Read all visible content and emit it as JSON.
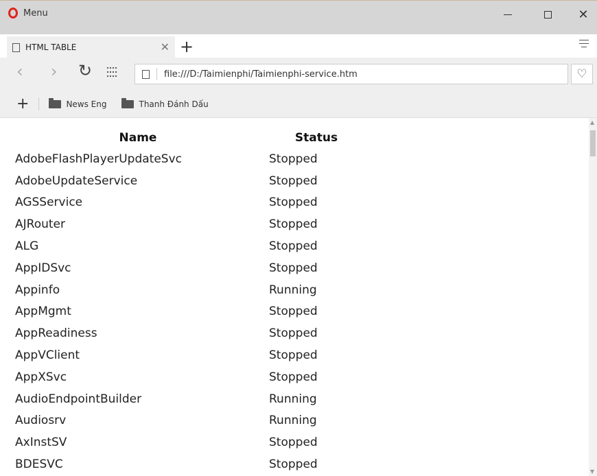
{
  "window": {
    "menu_label": "Menu",
    "minimize_glyph": "−",
    "maximize_glyph": "□",
    "close_glyph": "✕"
  },
  "tab": {
    "title": "HTML TABLE",
    "close_glyph": "✕",
    "new_glyph": "+"
  },
  "toolbar": {
    "back_glyph": "‹",
    "forward_glyph": "›",
    "reload_glyph": "↻",
    "url": "file:///D:/Taimienphi/Taimienphi-service.htm",
    "heart_glyph": "♡"
  },
  "bookmarks": {
    "add_glyph": "+",
    "items": [
      {
        "label": "News Eng",
        "icon": "folder-icon"
      },
      {
        "label": "Thanh Đánh Dấu",
        "icon": "folder-icon"
      }
    ]
  },
  "table": {
    "headers": {
      "name": "Name",
      "status": "Status"
    },
    "rows": [
      {
        "name": "AdobeFlashPlayerUpdateSvc",
        "status": "Stopped"
      },
      {
        "name": "AdobeUpdateService",
        "status": "Stopped"
      },
      {
        "name": "AGSService",
        "status": "Stopped"
      },
      {
        "name": "AJRouter",
        "status": "Stopped"
      },
      {
        "name": "ALG",
        "status": "Stopped"
      },
      {
        "name": "AppIDSvc",
        "status": "Stopped"
      },
      {
        "name": "Appinfo",
        "status": "Running"
      },
      {
        "name": "AppMgmt",
        "status": "Stopped"
      },
      {
        "name": "AppReadiness",
        "status": "Stopped"
      },
      {
        "name": "AppVClient",
        "status": "Stopped"
      },
      {
        "name": "AppXSvc",
        "status": "Stopped"
      },
      {
        "name": "AudioEndpointBuilder",
        "status": "Running"
      },
      {
        "name": "Audiosrv",
        "status": "Running"
      },
      {
        "name": "AxInstSV",
        "status": "Stopped"
      },
      {
        "name": "BDESVC",
        "status": "Stopped"
      }
    ]
  },
  "colors": {
    "titlebar": "#d6d6d6",
    "toolbar": "#efefef",
    "opera_red": "#e0241b"
  }
}
